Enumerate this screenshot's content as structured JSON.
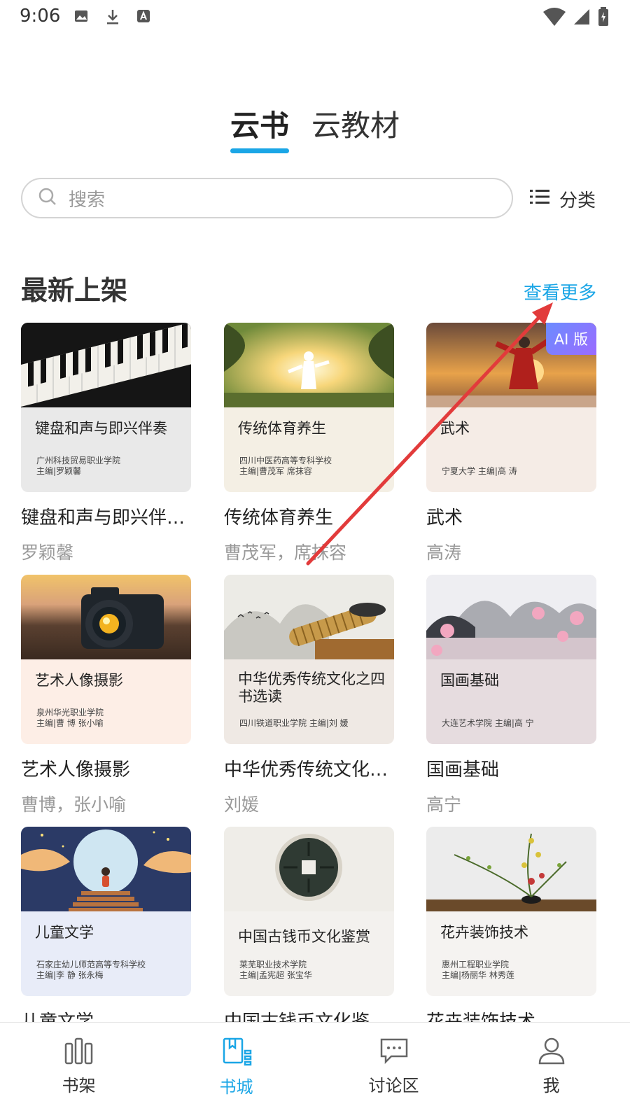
{
  "status_bar": {
    "time": "9:06"
  },
  "top_tabs": [
    {
      "label": "云书",
      "active": true
    },
    {
      "label": "云教材",
      "active": false
    }
  ],
  "search": {
    "placeholder": "搜索"
  },
  "category": {
    "label": "分类"
  },
  "section": {
    "title": "最新上架",
    "see_more": "查看更多"
  },
  "books": [
    {
      "cover_title": "键盘和声与即兴伴奏",
      "cover_meta": "广州科技贸易职业学院\n主编|罗颖馨",
      "title": "键盘和声与即兴伴…",
      "author": "罗颖馨",
      "badge": ""
    },
    {
      "cover_title": "传统体育养生",
      "cover_meta": "四川中医药高等专科学校\n主编|曹茂军   席抹容",
      "title": "传统体育养生",
      "author": "曹茂军，席抹容",
      "badge": ""
    },
    {
      "cover_title": "武术",
      "cover_meta": "宁夏大学   主编|高 涛",
      "title": "武术",
      "author": "高涛",
      "badge": "AI 版"
    },
    {
      "cover_title": "艺术人像摄影",
      "cover_meta": "泉州华光职业学院\n主编|曹   博   张小喻",
      "title": "艺术人像摄影",
      "author": "曹博，张小喻",
      "badge": ""
    },
    {
      "cover_title": "中华优秀传统文化之四书选读",
      "cover_meta": "四川铁道职业学院   主编|刘   媛",
      "title": "中华优秀传统文化…",
      "author": "刘媛",
      "badge": ""
    },
    {
      "cover_title": "国画基础",
      "cover_meta": "大连艺术学院   主编|高   宁",
      "title": "国画基础",
      "author": "高宁",
      "badge": ""
    },
    {
      "cover_title": "儿童文学",
      "cover_meta": "石家庄幼儿师范高等专科学校\n主编|李   静   张永梅",
      "title": "儿童文学",
      "author": "",
      "badge": ""
    },
    {
      "cover_title": "中国古钱币文化鉴赏",
      "cover_meta": "莱芜职业技术学院\n主编|孟宪超   张宝华",
      "title": "中国古钱币文化鉴",
      "author": "",
      "badge": ""
    },
    {
      "cover_title": "花卉装饰技术",
      "cover_meta": "惠州工程职业学院\n主编|杨丽华   林秀莲",
      "title": "花卉装饰技术",
      "author": "",
      "badge": ""
    }
  ],
  "bottom_nav": [
    {
      "label": "书架",
      "active": false
    },
    {
      "label": "书城",
      "active": true
    },
    {
      "label": "讨论区",
      "active": false
    },
    {
      "label": "我",
      "active": false
    }
  ],
  "colors": {
    "accent": "#1ba6e6",
    "annotation": "#e23b3b"
  }
}
